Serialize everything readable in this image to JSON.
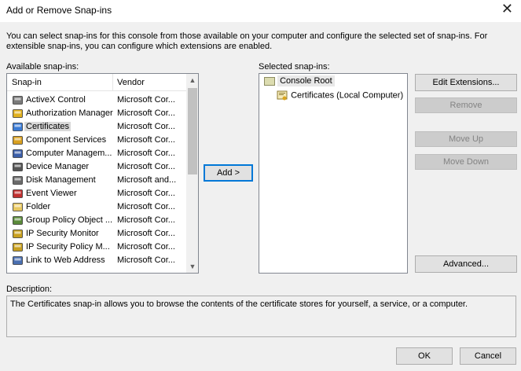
{
  "window": {
    "title": "Add or Remove Snap-ins",
    "close_glyph": "✕"
  },
  "intro_text": "You can select snap-ins for this console from those available on your computer and configure the selected set of snap-ins. For extensible snap-ins, you can configure which extensions are enabled.",
  "available": {
    "label": "Available snap-ins:",
    "col_snapin": "Snap-in",
    "col_vendor": "Vendor",
    "items": [
      {
        "name": "ActiveX Control",
        "vendor": "Microsoft Cor...",
        "icon": "activex-icon"
      },
      {
        "name": "Authorization Manager",
        "vendor": "Microsoft Cor...",
        "icon": "authorization-icon"
      },
      {
        "name": "Certificates",
        "vendor": "Microsoft Cor...",
        "icon": "certificates-icon"
      },
      {
        "name": "Component Services",
        "vendor": "Microsoft Cor...",
        "icon": "component-services-icon"
      },
      {
        "name": "Computer Managem...",
        "vendor": "Microsoft Cor...",
        "icon": "computer-management-icon"
      },
      {
        "name": "Device Manager",
        "vendor": "Microsoft Cor...",
        "icon": "device-manager-icon"
      },
      {
        "name": "Disk Management",
        "vendor": "Microsoft and...",
        "icon": "disk-management-icon"
      },
      {
        "name": "Event Viewer",
        "vendor": "Microsoft Cor...",
        "icon": "event-viewer-icon"
      },
      {
        "name": "Folder",
        "vendor": "Microsoft Cor...",
        "icon": "folder-icon"
      },
      {
        "name": "Group Policy Object ...",
        "vendor": "Microsoft Cor...",
        "icon": "group-policy-icon"
      },
      {
        "name": "IP Security Monitor",
        "vendor": "Microsoft Cor...",
        "icon": "ip-security-icon"
      },
      {
        "name": "IP Security Policy M...",
        "vendor": "Microsoft Cor...",
        "icon": "ip-security-policy-icon"
      },
      {
        "name": "Link to Web Address",
        "vendor": "Microsoft Cor...",
        "icon": "link-icon"
      }
    ]
  },
  "add_button": "Add >",
  "selected": {
    "label": "Selected snap-ins:",
    "root": "Console Root",
    "child": "Certificates (Local Computer)"
  },
  "buttons": {
    "edit_extensions": "Edit Extensions...",
    "remove": "Remove",
    "move_up": "Move Up",
    "move_down": "Move Down",
    "advanced": "Advanced...",
    "ok": "OK",
    "cancel": "Cancel"
  },
  "description": {
    "label": "Description:",
    "text": "The Certificates snap-in allows you to browse the contents of the certificate stores for yourself, a service, or a computer."
  },
  "colors": {
    "selection": "#d9d9d9",
    "focus_border": "#0078d7"
  }
}
